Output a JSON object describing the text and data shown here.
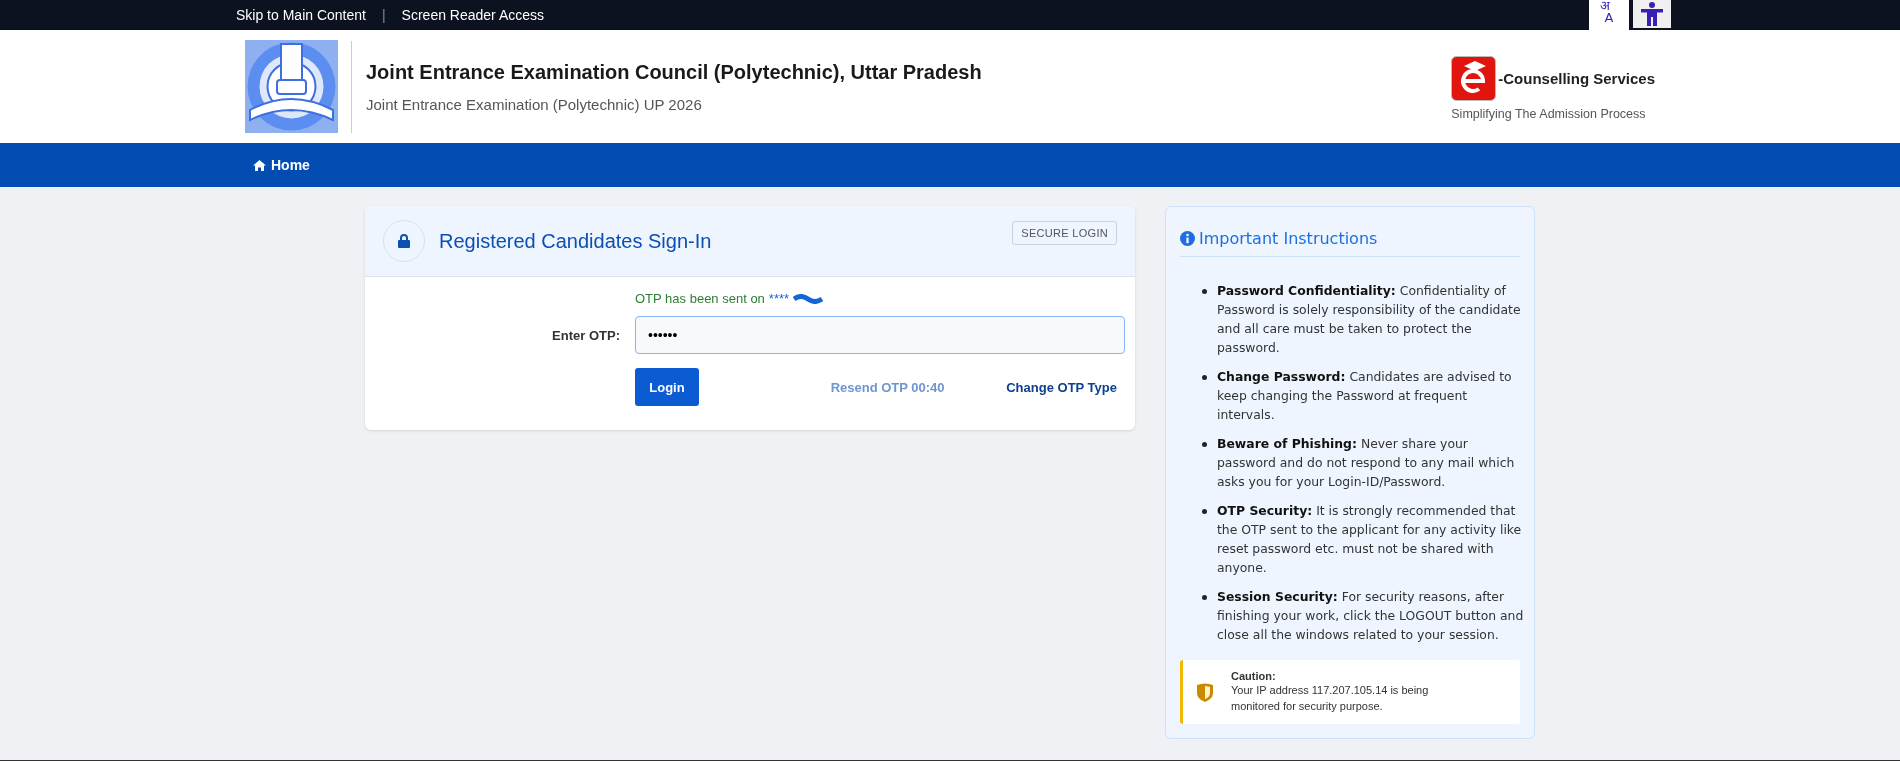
{
  "top_bar": {
    "links": [
      {
        "label": "Skip to Main Content"
      },
      {
        "label": "Screen Reader Access"
      }
    ],
    "separator": "|",
    "language_letters": [
      "अ",
      "A"
    ]
  },
  "header": {
    "title": "Joint Entrance Examination Council (Polytechnic), Uttar Pradesh",
    "subtitle": "Joint Entrance Examination (Polytechnic) UP 2026",
    "brand": {
      "name": "-Counselling Services",
      "tagline": "Simplifying The Admission Process"
    }
  },
  "nav": [
    {
      "label": "Home",
      "selected": true
    }
  ],
  "signin": {
    "title": "Registered Candidates Sign-In",
    "badge": "SECURE LOGIN",
    "otp_message": "OTP has been sent on",
    "masked_number": "****",
    "field_label": "Enter OTP:",
    "field_value": "••••••",
    "login_button": "Login",
    "resend": {
      "label": "Resend OTP 00:40",
      "disabled": true
    },
    "change_link": "Change OTP Type"
  },
  "instructions": {
    "title": "Important Instructions",
    "items": [
      {
        "term": "Password Confidentiality:",
        "text": "Confidentiality of Password is solely responsibility of the candidate and all care must be taken to protect the password."
      },
      {
        "term": "Change Password:",
        "text": "Candidates are advised to keep changing the Password at frequent intervals."
      },
      {
        "term": "Beware of Phishing:",
        "text": "Never share your password and do not respond to any mail which asks you for your Login-ID/Password."
      },
      {
        "term": "OTP Security:",
        "text": "It is strongly recommended that the OTP sent to the applicant for any activity like reset password etc. must not be shared with anyone."
      },
      {
        "term": "Session Security:",
        "text": "For security reasons, after finishing your work, click the LOGOUT button and close all the windows related to your session."
      }
    ],
    "caution": {
      "title": "Caution:",
      "text": "Your IP address 117.207.105.14 is being monitored for security purpose."
    }
  }
}
